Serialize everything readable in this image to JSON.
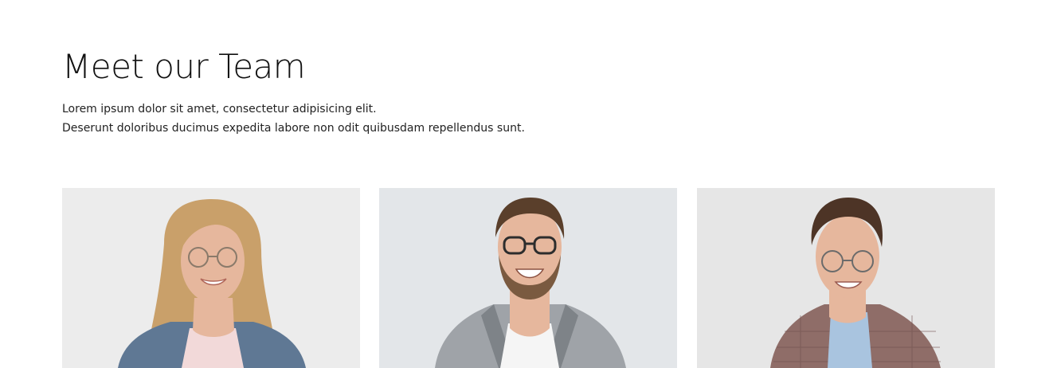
{
  "team": {
    "title": "Meet our Team",
    "description": [
      "Lorem ipsum dolor sit amet, consectetur adipisicing elit.",
      "Deserunt doloribus ducimus expedita labore non odit quibusdam repellendus sunt."
    ],
    "members": [
      {
        "photo": "woman-blonde-glasses-portrait",
        "background": "#ececec",
        "hair": "#c9a06a",
        "jacket": "#5f7894",
        "shirt": "#f2d9d9"
      },
      {
        "photo": "man-beard-glasses-portrait",
        "background": "#e3e6e9",
        "hair": "#5a3f2b",
        "jacket": "#9fa3a8",
        "shirt": "#f5f5f5"
      },
      {
        "photo": "man-plaid-blazer-portrait",
        "background": "#e6e6e6",
        "hair": "#4d3426",
        "jacket": "#8f6d68",
        "shirt": "#a9c4df"
      }
    ]
  },
  "colors": {
    "skin": "#e6b79d",
    "text": "#111111"
  }
}
